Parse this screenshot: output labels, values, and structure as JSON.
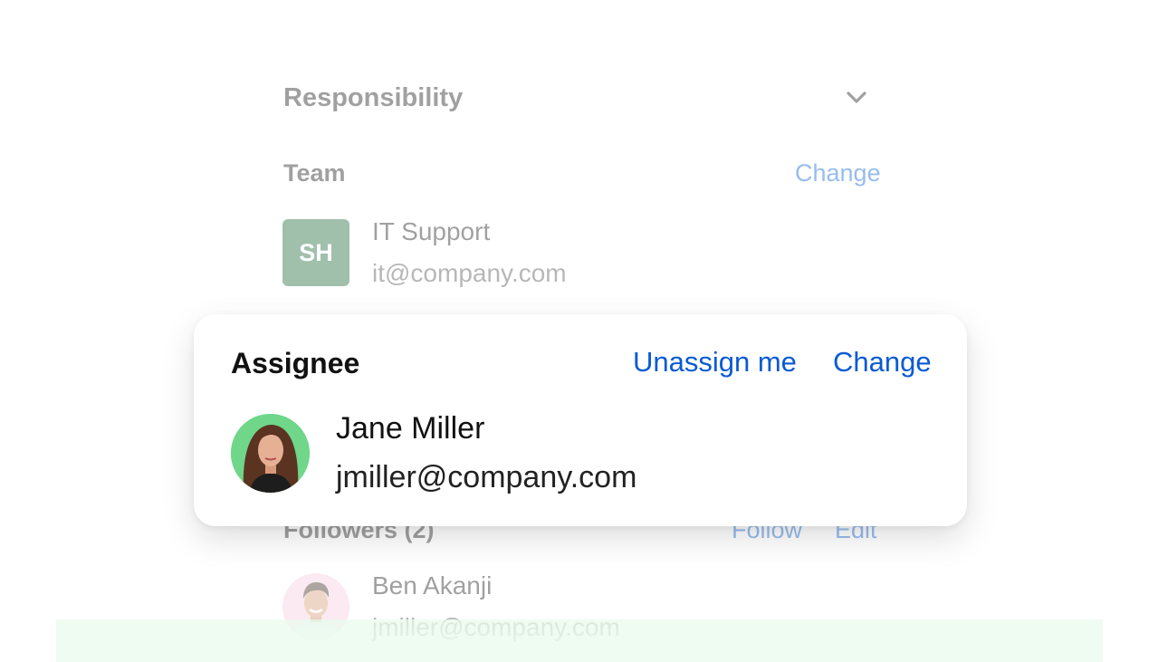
{
  "responsibility": {
    "section_title": "Responsibility",
    "toggle_icon": "chevron-down-icon"
  },
  "team": {
    "label": "Team",
    "change_label": "Change",
    "initials": "SH",
    "name": "IT Support",
    "email": "it@company.com",
    "avatar_color": "#1f6b3c"
  },
  "assignee": {
    "label": "Assignee",
    "unassign_label": "Unassign me",
    "change_label": "Change",
    "name": "Jane Miller",
    "email": "jmiller@company.com",
    "avatar_bg": "#6fd68a"
  },
  "followers": {
    "label": "Followers (2)",
    "follow_label": "Follow",
    "edit_label": "Edit",
    "items": [
      {
        "name": "Ben Akanji",
        "email": "jmiller@company.com",
        "avatar_bg": "#f7cfe0"
      }
    ]
  },
  "colors": {
    "link": "#0a5ad4",
    "text": "#111111"
  }
}
